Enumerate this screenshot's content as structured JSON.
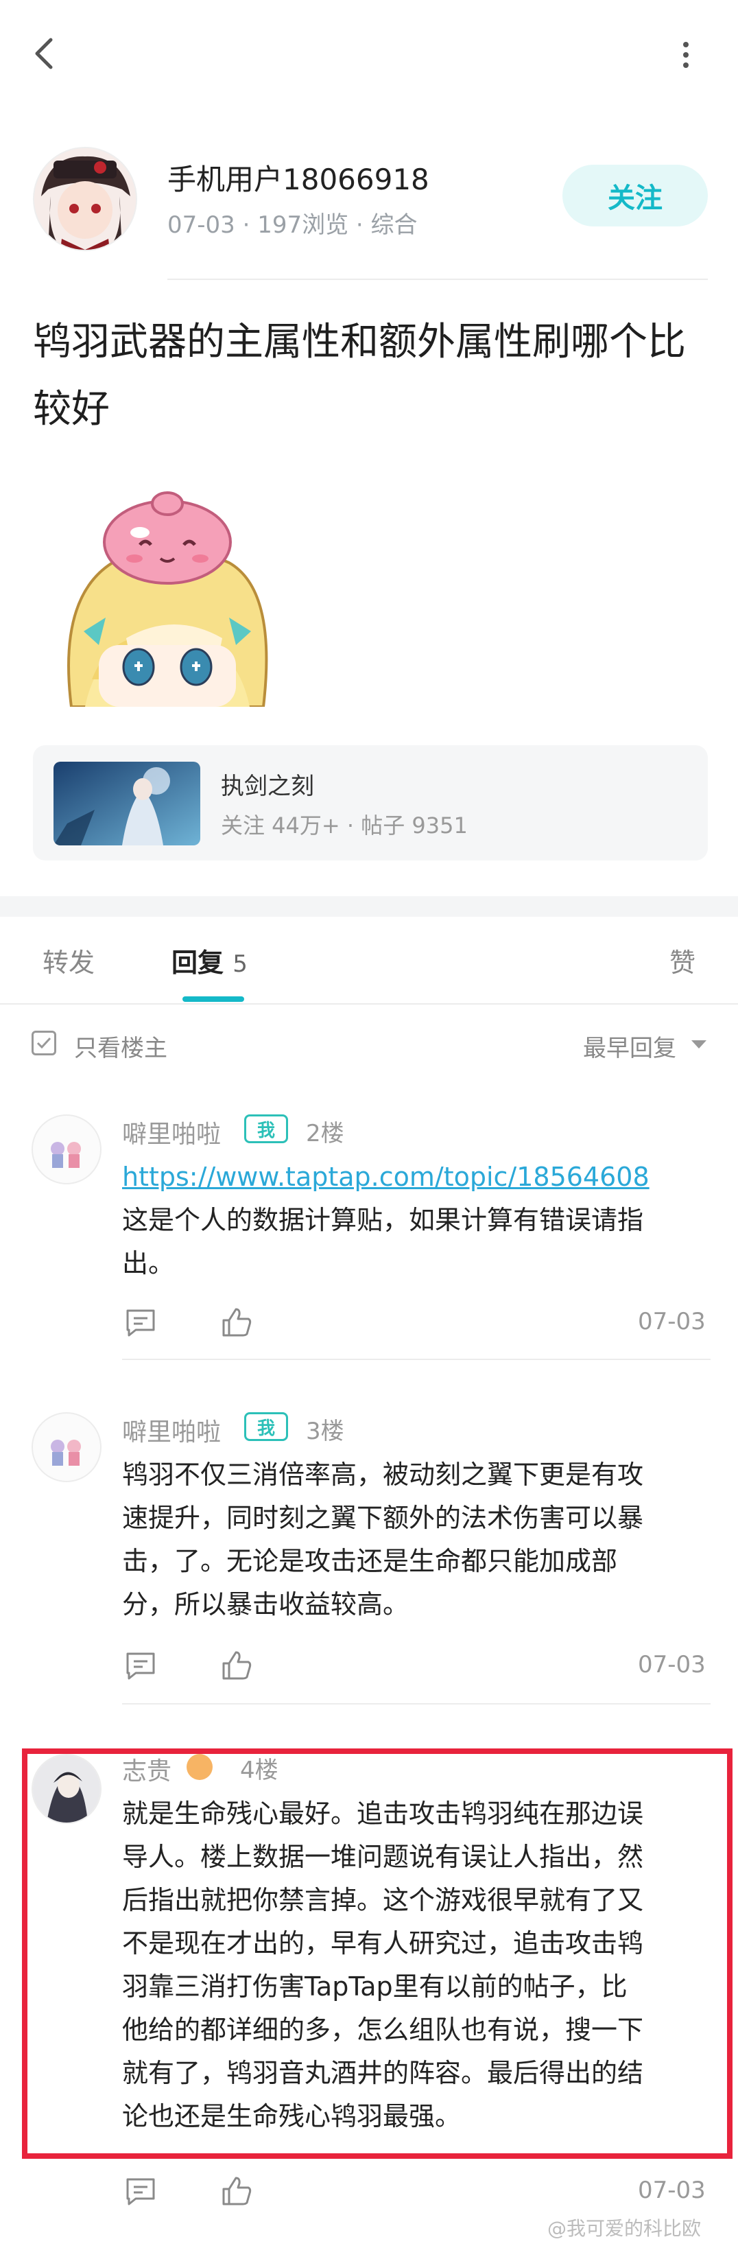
{
  "post": {
    "author": "手机用户18066918",
    "meta": "07-03 · 197浏览 · 综合",
    "follow_label": "关注",
    "title": "鸨羽武器的主属性和额外属性刷哪个比较好"
  },
  "topic": {
    "name": "执剑之刻",
    "stats": "关注 44万+ · 帖子 9351"
  },
  "tabs": [
    {
      "label": "转发"
    },
    {
      "label": "回复",
      "count": "5"
    },
    {
      "label": "赞"
    }
  ],
  "filter": {
    "only_op_label": "只看楼主",
    "sort_label": "最早回复"
  },
  "comments": [
    {
      "name": "噼里啪啦",
      "badge": "我",
      "floor": "2楼",
      "link": "https://www.taptap.com/topic/18564608",
      "lines": [
        "这是个人的数据计算贴，如果计算有错误请指",
        "出。"
      ],
      "date": "07-03"
    },
    {
      "name": "噼里啪啦",
      "badge": "我",
      "floor": "3楼",
      "lines": [
        "鸨羽不仅三消倍率高，被动刻之翼下更是有攻",
        "速提升，同时刻之翼下额外的法术伤害可以暴",
        "击，了。无论是攻击还是生命都只能加成部",
        "分，所以暴击收益较高。"
      ],
      "date": "07-03"
    },
    {
      "name": "志贵",
      "floor": "4楼",
      "lines": [
        "就是生命残心最好。追击攻击鸨羽纯在那边误",
        "导人。楼上数据一堆问题说有误让人指出，然",
        "后指出就把你禁言掉。这个游戏很早就有了又",
        "不是现在才出的，早有人研究过，追击攻击鸨",
        "羽靠三消打伤害TapTap里有以前的帖子，比",
        "他给的都详细的多，怎么组队也有说，搜一下",
        "就有了，鸨羽音丸酒井的阵容。最后得出的结",
        "论也还是生命残心鸨羽最强。"
      ],
      "date": "07-03"
    }
  ],
  "watermark": "@我可爱的科比欧",
  "colors": {
    "accent": "#14b9c8",
    "follow_bg": "#e4f8f8",
    "highlight_box": "#e8233c",
    "link": "#2aa8d8"
  }
}
